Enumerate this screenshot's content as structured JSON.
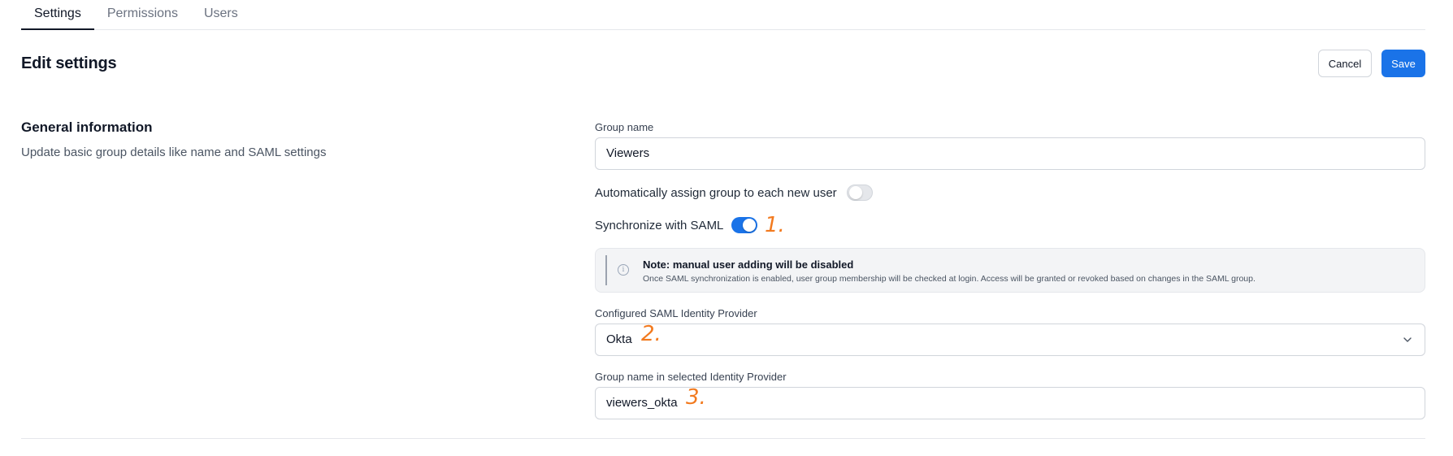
{
  "tabs": [
    {
      "label": "Settings",
      "active": true
    },
    {
      "label": "Permissions",
      "active": false
    },
    {
      "label": "Users",
      "active": false
    }
  ],
  "header": {
    "title": "Edit settings",
    "cancel_label": "Cancel",
    "save_label": "Save"
  },
  "section": {
    "title": "General information",
    "description": "Update basic group details like name and SAML settings"
  },
  "form": {
    "group_name_label": "Group name",
    "group_name_value": "Viewers",
    "auto_assign_label": "Automatically assign group to each new user",
    "auto_assign_on": false,
    "saml_sync_label": "Synchronize with SAML",
    "saml_sync_on": true,
    "note_title": "Note: manual user adding will be disabled",
    "note_text": "Once SAML synchronization is enabled, user group membership will be checked at login. Access will be granted or revoked based on changes in the SAML group.",
    "idp_label": "Configured SAML Identity Provider",
    "idp_value": "Okta",
    "idp_group_label": "Group name in selected Identity Provider",
    "idp_group_value": "viewers_okta"
  },
  "annotations": {
    "one": "1.",
    "two": "2.",
    "three": "3."
  },
  "icons": {
    "info": "info-icon",
    "chevron": "chevron-down-icon"
  },
  "colors": {
    "accent": "#1a73e8",
    "annotation": "#f27a1f"
  }
}
